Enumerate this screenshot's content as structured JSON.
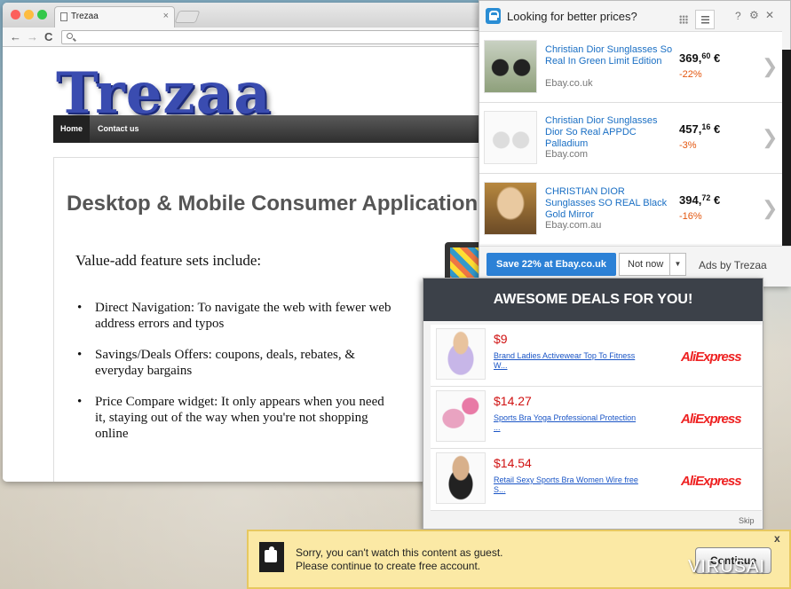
{
  "browser": {
    "tab_title": "Trezaa",
    "tab_close": "×",
    "nav_back": "←",
    "nav_forward": "→",
    "nav_reload": "C"
  },
  "site": {
    "logo": "Trezaa",
    "menu": [
      "Home",
      "Contact us"
    ],
    "heading": "Desktop & Mobile Consumer Applications",
    "subheading": "Value-add feature sets include:",
    "bullets": [
      "Direct Navigation:  To navigate the web with fewer web address errors and typos",
      "Savings/Deals Offers:  coupons, deals, rebates, & everyday bargains",
      "Price Compare widget:  It only appears when you need it, staying out of the way when you're not shopping online"
    ]
  },
  "prices_panel": {
    "title": "Looking for better prices?",
    "help": "?",
    "settings": "⚙",
    "close": "✕",
    "items": [
      {
        "name": "Christian Dior Sunglasses So Real In Green Limit Edition",
        "source": "Ebay.co.uk",
        "price_int": "369,",
        "price_dec": "60",
        "currency": " €",
        "discount": "-22%"
      },
      {
        "name": "Christian Dior Sunglasses Dior So Real APPDC Palladium",
        "source": "Ebay.com",
        "price_int": "457,",
        "price_dec": "16",
        "currency": " €",
        "discount": "-3%"
      },
      {
        "name": "CHRISTIAN DIOR Sunglasses SO REAL Black Gold Mirror",
        "source": "Ebay.com.au",
        "price_int": "394,",
        "price_dec": "72",
        "currency": " €",
        "discount": "-16%"
      }
    ],
    "chevron": "❯",
    "save_button": "Save 22% at Ebay.co.uk",
    "not_now": "Not now",
    "dropdown_arrow": "▼",
    "ads_by": "Ads by Trezaa"
  },
  "deals_panel": {
    "title": "AWESOME DEALS FOR YOU!",
    "items": [
      {
        "price": "$9",
        "name": "Brand Ladies Activewear Top To Fitness W...",
        "store": "AliExpress"
      },
      {
        "price": "$14.27",
        "name": "Sports Bra Yoga Professional Protection ...",
        "store": "AliExpress"
      },
      {
        "price": "$14.54",
        "name": "Retail Sexy Sports Bra Women Wire free S...",
        "store": "AliExpress"
      }
    ],
    "skip": "Skip"
  },
  "guest_bar": {
    "line1": "Sorry, you can't watch this content as guest.",
    "line2": "Please continue to create free account.",
    "button": "Continue",
    "close": "x"
  },
  "watermark": "VIRUSAI",
  "colors": {
    "accent": "#2c81d6",
    "deal_price": "#d01212",
    "discount": "#e3560e",
    "guest_bg": "#fbe9a5"
  }
}
